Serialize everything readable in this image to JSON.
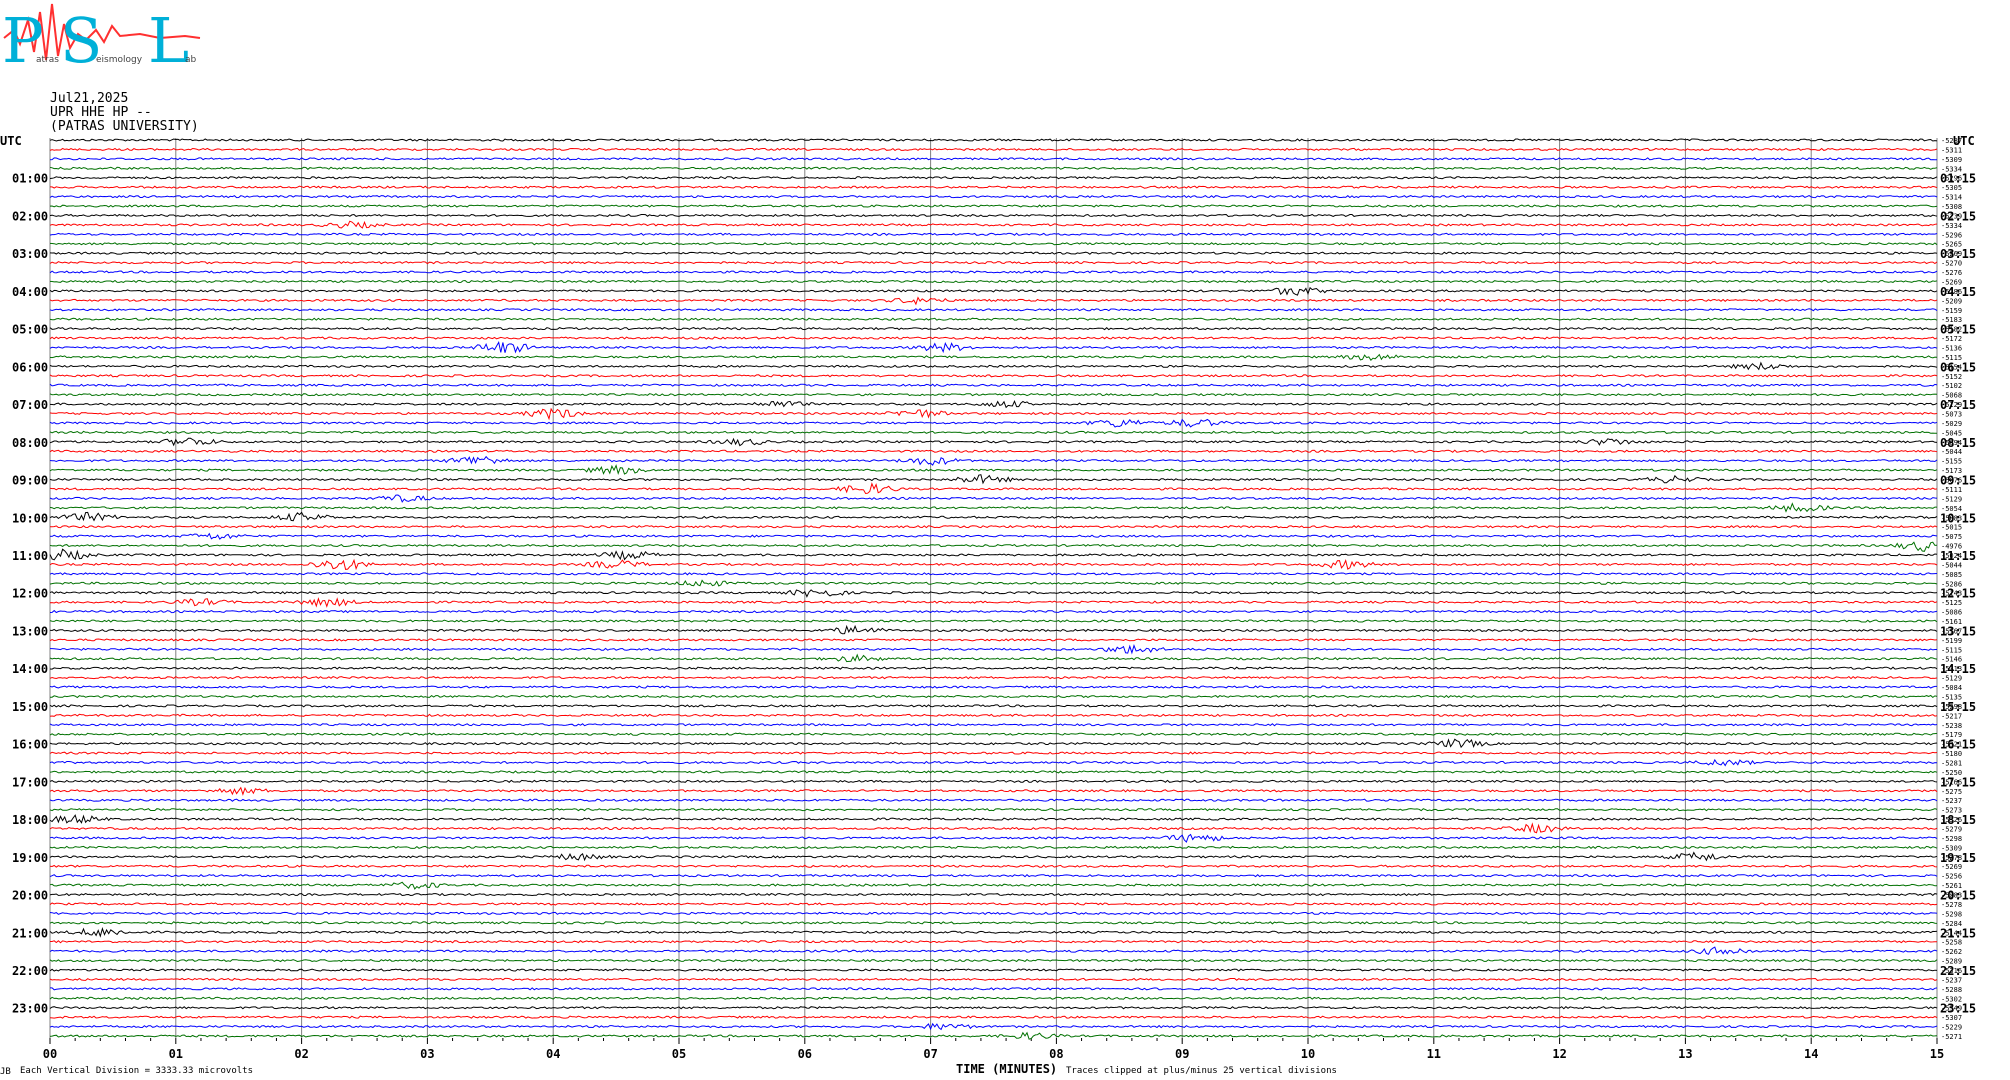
{
  "logo": {
    "letters": [
      "P",
      "S",
      "L"
    ],
    "small_texts": [
      "atras",
      "eismology",
      "ab"
    ]
  },
  "header": {
    "date": "Jul21,2025",
    "station": "UPR HHE HP --",
    "institution": "(PATRAS UNIVERSITY)"
  },
  "footer": {
    "left_mark": "JB",
    "division": "Each Vertical Division = 3333.33 microvolts",
    "clip": "Traces clipped at plus/minus 25 vertical divisions"
  },
  "colors": {
    "cycle": [
      "#000000",
      "#ff0000",
      "#0000ff",
      "#007000"
    ],
    "grid": "#808080",
    "logo": "#00b0d8",
    "logo_wave": "#ff3030"
  },
  "chart_data": {
    "type": "line",
    "title": "",
    "xlabel": "TIME (MINUTES)",
    "ylabel": "",
    "left_axis_title": "UTC",
    "right_axis_title": "UTC",
    "x_ticks": [
      "00",
      "01",
      "02",
      "03",
      "04",
      "05",
      "06",
      "07",
      "08",
      "09",
      "10",
      "11",
      "12",
      "13",
      "14",
      "15"
    ],
    "xlim": [
      0,
      15
    ],
    "rows_per_hour": 4,
    "minutes_per_row": 15,
    "left_labels": [
      "01:00",
      "02:00",
      "03:00",
      "04:00",
      "05:00",
      "06:00",
      "07:00",
      "08:00",
      "09:00",
      "10:00",
      "11:00",
      "12:00",
      "13:00",
      "14:00",
      "15:00",
      "16:00",
      "17:00",
      "18:00",
      "19:00",
      "20:00",
      "21:00",
      "22:00",
      "23:00"
    ],
    "right_labels": [
      "01:15",
      "02:15",
      "03:15",
      "04:15",
      "05:15",
      "06:15",
      "07:15",
      "08:15",
      "09:15",
      "10:15",
      "11:15",
      "12:15",
      "13:15",
      "14:15",
      "15:15",
      "16:15",
      "17:15",
      "18:15",
      "19:15",
      "20:15",
      "21:15",
      "22:15",
      "23:15"
    ],
    "row_offsets": [
      "-5287",
      "-5311",
      "-5309",
      "-5334",
      "-5296",
      "-5305",
      "-5314",
      "-5308",
      "-5239",
      "-5334",
      "-5296",
      "-5265",
      "-5269",
      "-5270",
      "-5276",
      "-5269",
      "-5286",
      "-5209",
      "-5159",
      "-5183",
      "-5182",
      "-5172",
      "-5136",
      "-5115",
      "-5154",
      "-5152",
      "-5102",
      "-5068",
      "-5129",
      "-5073",
      "-5029",
      "-5045",
      "-5094",
      "-5044",
      "-5155",
      "-5173",
      "-5076",
      "-5111",
      "-5129",
      "-5054",
      "-5083",
      "-5015",
      "-5075",
      "-4976",
      "-5024",
      "-5044",
      "-5085",
      "-5286",
      "-5143",
      "-5125",
      "-5086",
      "-5161",
      "-5167",
      "-5199",
      "-5115",
      "-5146",
      "-5313",
      "-5129",
      "-5084",
      "-5135",
      "-5298",
      "-5217",
      "-5238",
      "-5179",
      "-5321",
      "-5180",
      "-5281",
      "-5250",
      "-5166",
      "-5275",
      "-5237",
      "-5273",
      "-5326",
      "-5279",
      "-5298",
      "-5309",
      "-5278",
      "-5269",
      "-5256",
      "-5261",
      "-5283",
      "-5278",
      "-5298",
      "-5284",
      "-5144",
      "-5258",
      "-5262",
      "-5289",
      "-5316",
      "-5237",
      "-5288",
      "-5302",
      "-5349",
      "-5307",
      "-5229",
      "-5271"
    ],
    "series": [
      {
        "name": "",
        "color": "#000000",
        "rows": "0,4,8,...,92"
      },
      {
        "name": "",
        "color": "#ff0000",
        "rows": "1,5,9,...,93"
      },
      {
        "name": "",
        "color": "#0000ff",
        "rows": "2,6,10,...,94"
      },
      {
        "name": "",
        "color": "#007000",
        "rows": "3,7,11,...,95"
      }
    ],
    "events": [
      {
        "row": 9,
        "minute": 2.4,
        "amp": 3
      },
      {
        "row": 16,
        "minute": 9.9,
        "amp": 4
      },
      {
        "row": 17,
        "minute": 6.9,
        "amp": 3
      },
      {
        "row": 22,
        "minute": 3.6,
        "amp": 6
      },
      {
        "row": 22,
        "minute": 7.1,
        "amp": 4
      },
      {
        "row": 23,
        "minute": 10.5,
        "amp": 3
      },
      {
        "row": 24,
        "minute": 13.6,
        "amp": 3
      },
      {
        "row": 28,
        "minute": 5.8,
        "amp": 3
      },
      {
        "row": 28,
        "minute": 7.6,
        "amp": 3
      },
      {
        "row": 29,
        "minute": 4.0,
        "amp": 5
      },
      {
        "row": 29,
        "minute": 6.9,
        "amp": 4
      },
      {
        "row": 30,
        "minute": 8.5,
        "amp": 4
      },
      {
        "row": 30,
        "minute": 9.1,
        "amp": 4
      },
      {
        "row": 32,
        "minute": 1.1,
        "amp": 4
      },
      {
        "row": 32,
        "minute": 5.5,
        "amp": 3
      },
      {
        "row": 32,
        "minute": 12.4,
        "amp": 3
      },
      {
        "row": 34,
        "minute": 3.4,
        "amp": 5
      },
      {
        "row": 34,
        "minute": 7.0,
        "amp": 4
      },
      {
        "row": 35,
        "minute": 4.5,
        "amp": 4
      },
      {
        "row": 36,
        "minute": 7.4,
        "amp": 4
      },
      {
        "row": 36,
        "minute": 12.9,
        "amp": 3
      },
      {
        "row": 37,
        "minute": 6.5,
        "amp": 5
      },
      {
        "row": 38,
        "minute": 2.8,
        "amp": 3
      },
      {
        "row": 39,
        "minute": 13.9,
        "amp": 4
      },
      {
        "row": 40,
        "minute": 0.3,
        "amp": 4
      },
      {
        "row": 40,
        "minute": 2.0,
        "amp": 4
      },
      {
        "row": 42,
        "minute": 1.3,
        "amp": 3
      },
      {
        "row": 43,
        "minute": 14.9,
        "amp": 5
      },
      {
        "row": 44,
        "minute": 0.1,
        "amp": 5
      },
      {
        "row": 44,
        "minute": 4.6,
        "amp": 4
      },
      {
        "row": 45,
        "minute": 2.3,
        "amp": 6
      },
      {
        "row": 45,
        "minute": 4.5,
        "amp": 4
      },
      {
        "row": 45,
        "minute": 10.3,
        "amp": 4
      },
      {
        "row": 47,
        "minute": 5.2,
        "amp": 3
      },
      {
        "row": 48,
        "minute": 6.1,
        "amp": 4
      },
      {
        "row": 49,
        "minute": 2.2,
        "amp": 4
      },
      {
        "row": 49,
        "minute": 1.2,
        "amp": 3
      },
      {
        "row": 52,
        "minute": 6.4,
        "amp": 4
      },
      {
        "row": 54,
        "minute": 8.6,
        "amp": 4
      },
      {
        "row": 55,
        "minute": 6.4,
        "amp": 3
      },
      {
        "row": 64,
        "minute": 11.2,
        "amp": 4
      },
      {
        "row": 66,
        "minute": 13.3,
        "amp": 3
      },
      {
        "row": 69,
        "minute": 1.5,
        "amp": 3
      },
      {
        "row": 72,
        "minute": 0.2,
        "amp": 4
      },
      {
        "row": 73,
        "minute": 11.8,
        "amp": 4
      },
      {
        "row": 74,
        "minute": 9.1,
        "amp": 4
      },
      {
        "row": 76,
        "minute": 4.2,
        "amp": 3
      },
      {
        "row": 76,
        "minute": 13.1,
        "amp": 4
      },
      {
        "row": 79,
        "minute": 2.9,
        "amp": 3
      },
      {
        "row": 84,
        "minute": 0.4,
        "amp": 4
      },
      {
        "row": 86,
        "minute": 13.3,
        "amp": 4
      },
      {
        "row": 94,
        "minute": 7.1,
        "amp": 3
      },
      {
        "row": 95,
        "minute": 7.8,
        "amp": 3
      }
    ]
  }
}
